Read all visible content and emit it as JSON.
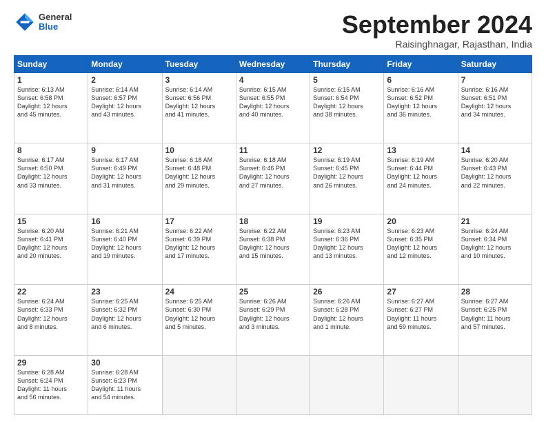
{
  "header": {
    "logo_general": "General",
    "logo_blue": "Blue",
    "title": "September 2024",
    "location": "Raisinghnagar, Rajasthan, India"
  },
  "calendar": {
    "headers": [
      "Sunday",
      "Monday",
      "Tuesday",
      "Wednesday",
      "Thursday",
      "Friday",
      "Saturday"
    ],
    "weeks": [
      [
        {
          "day": "",
          "empty": true
        },
        {
          "day": "",
          "empty": true
        },
        {
          "day": "",
          "empty": true
        },
        {
          "day": "",
          "empty": true
        },
        {
          "day": "",
          "empty": true
        },
        {
          "day": "",
          "empty": true
        },
        {
          "day": "",
          "empty": true
        }
      ],
      [
        {
          "day": "1",
          "info": "Sunrise: 6:13 AM\nSunset: 6:58 PM\nDaylight: 12 hours\nand 45 minutes."
        },
        {
          "day": "2",
          "info": "Sunrise: 6:14 AM\nSunset: 6:57 PM\nDaylight: 12 hours\nand 43 minutes."
        },
        {
          "day": "3",
          "info": "Sunrise: 6:14 AM\nSunset: 6:56 PM\nDaylight: 12 hours\nand 41 minutes."
        },
        {
          "day": "4",
          "info": "Sunrise: 6:15 AM\nSunset: 6:55 PM\nDaylight: 12 hours\nand 40 minutes."
        },
        {
          "day": "5",
          "info": "Sunrise: 6:15 AM\nSunset: 6:54 PM\nDaylight: 12 hours\nand 38 minutes."
        },
        {
          "day": "6",
          "info": "Sunrise: 6:16 AM\nSunset: 6:52 PM\nDaylight: 12 hours\nand 36 minutes."
        },
        {
          "day": "7",
          "info": "Sunrise: 6:16 AM\nSunset: 6:51 PM\nDaylight: 12 hours\nand 34 minutes."
        }
      ],
      [
        {
          "day": "8",
          "info": "Sunrise: 6:17 AM\nSunset: 6:50 PM\nDaylight: 12 hours\nand 33 minutes."
        },
        {
          "day": "9",
          "info": "Sunrise: 6:17 AM\nSunset: 6:49 PM\nDaylight: 12 hours\nand 31 minutes."
        },
        {
          "day": "10",
          "info": "Sunrise: 6:18 AM\nSunset: 6:48 PM\nDaylight: 12 hours\nand 29 minutes."
        },
        {
          "day": "11",
          "info": "Sunrise: 6:18 AM\nSunset: 6:46 PM\nDaylight: 12 hours\nand 27 minutes."
        },
        {
          "day": "12",
          "info": "Sunrise: 6:19 AM\nSunset: 6:45 PM\nDaylight: 12 hours\nand 26 minutes."
        },
        {
          "day": "13",
          "info": "Sunrise: 6:19 AM\nSunset: 6:44 PM\nDaylight: 12 hours\nand 24 minutes."
        },
        {
          "day": "14",
          "info": "Sunrise: 6:20 AM\nSunset: 6:43 PM\nDaylight: 12 hours\nand 22 minutes."
        }
      ],
      [
        {
          "day": "15",
          "info": "Sunrise: 6:20 AM\nSunset: 6:41 PM\nDaylight: 12 hours\nand 20 minutes."
        },
        {
          "day": "16",
          "info": "Sunrise: 6:21 AM\nSunset: 6:40 PM\nDaylight: 12 hours\nand 19 minutes."
        },
        {
          "day": "17",
          "info": "Sunrise: 6:22 AM\nSunset: 6:39 PM\nDaylight: 12 hours\nand 17 minutes."
        },
        {
          "day": "18",
          "info": "Sunrise: 6:22 AM\nSunset: 6:38 PM\nDaylight: 12 hours\nand 15 minutes."
        },
        {
          "day": "19",
          "info": "Sunrise: 6:23 AM\nSunset: 6:36 PM\nDaylight: 12 hours\nand 13 minutes."
        },
        {
          "day": "20",
          "info": "Sunrise: 6:23 AM\nSunset: 6:35 PM\nDaylight: 12 hours\nand 12 minutes."
        },
        {
          "day": "21",
          "info": "Sunrise: 6:24 AM\nSunset: 6:34 PM\nDaylight: 12 hours\nand 10 minutes."
        }
      ],
      [
        {
          "day": "22",
          "info": "Sunrise: 6:24 AM\nSunset: 6:33 PM\nDaylight: 12 hours\nand 8 minutes."
        },
        {
          "day": "23",
          "info": "Sunrise: 6:25 AM\nSunset: 6:32 PM\nDaylight: 12 hours\nand 6 minutes."
        },
        {
          "day": "24",
          "info": "Sunrise: 6:25 AM\nSunset: 6:30 PM\nDaylight: 12 hours\nand 5 minutes."
        },
        {
          "day": "25",
          "info": "Sunrise: 6:26 AM\nSunset: 6:29 PM\nDaylight: 12 hours\nand 3 minutes."
        },
        {
          "day": "26",
          "info": "Sunrise: 6:26 AM\nSunset: 6:28 PM\nDaylight: 12 hours\nand 1 minute."
        },
        {
          "day": "27",
          "info": "Sunrise: 6:27 AM\nSunset: 6:27 PM\nDaylight: 11 hours\nand 59 minutes."
        },
        {
          "day": "28",
          "info": "Sunrise: 6:27 AM\nSunset: 6:25 PM\nDaylight: 11 hours\nand 57 minutes."
        }
      ],
      [
        {
          "day": "29",
          "info": "Sunrise: 6:28 AM\nSunset: 6:24 PM\nDaylight: 11 hours\nand 56 minutes."
        },
        {
          "day": "30",
          "info": "Sunrise: 6:28 AM\nSunset: 6:23 PM\nDaylight: 11 hours\nand 54 minutes."
        },
        {
          "day": "",
          "empty": true
        },
        {
          "day": "",
          "empty": true
        },
        {
          "day": "",
          "empty": true
        },
        {
          "day": "",
          "empty": true
        },
        {
          "day": "",
          "empty": true
        }
      ]
    ]
  }
}
